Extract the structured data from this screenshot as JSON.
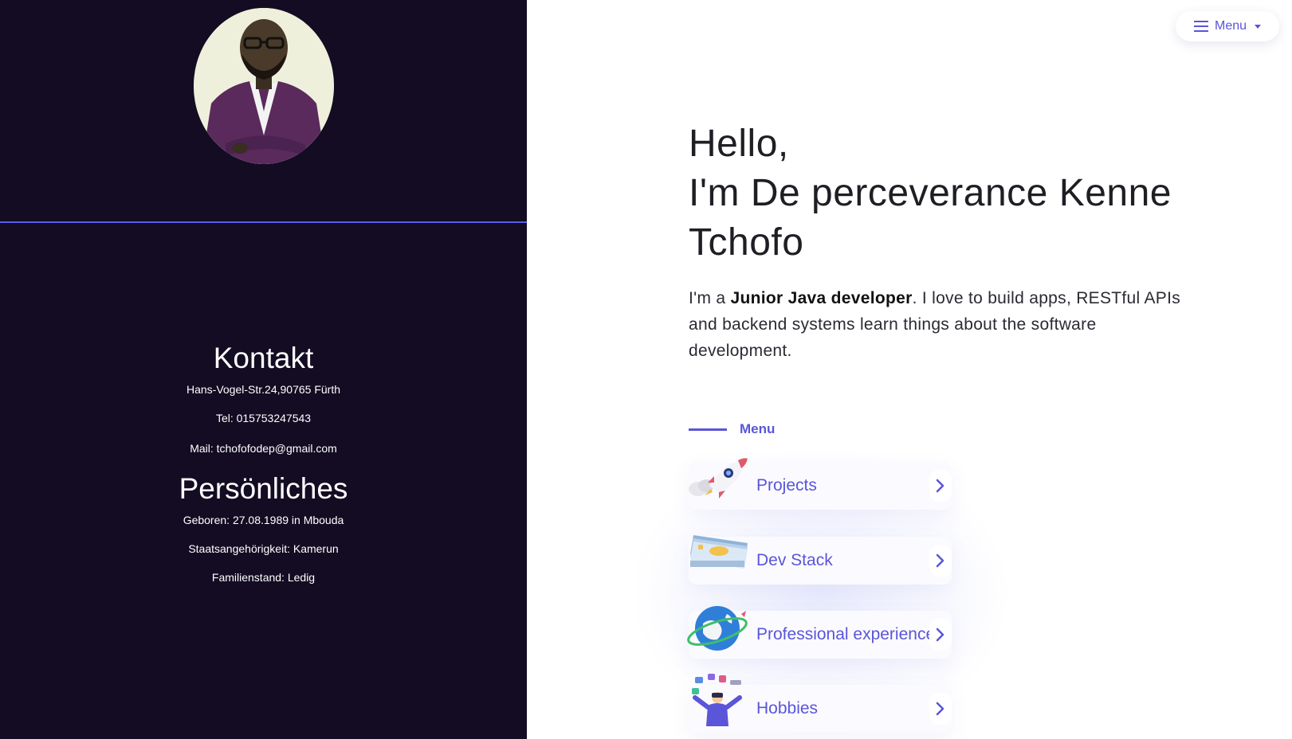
{
  "menu_button": {
    "label": "Menu",
    "icon": "hamburger-icon"
  },
  "profile": {
    "photo_alt": "profile photo"
  },
  "contact": {
    "heading": "Kontakt",
    "address": "Hans-Vogel-Str.24,90765 Fürth",
    "phone": "Tel: 015753247543",
    "mail": "Mail: tchofofodep@gmail.com"
  },
  "personal": {
    "heading": "Persönliches",
    "born": "Geboren: 27.08.1989 in Mbouda",
    "nationality": "Staatsangehörigkeit: Kamerun",
    "marital": "Familienstand: Ledig"
  },
  "hero": {
    "greeting": "Hello,",
    "name_line1": "I'm De perceverance Kenne",
    "name_line2": "Tchofo",
    "intro_prefix": "I'm a ",
    "intro_role": "Junior Java developer",
    "intro_rest": ". I love to build apps, RESTful APIs and backend systems learn things about the software development."
  },
  "menu_section": {
    "label": "Menu",
    "items": [
      {
        "label": "Projects",
        "icon": "rocket-icon"
      },
      {
        "label": "Dev Stack",
        "icon": "cash-stack-icon"
      },
      {
        "label": "Professional experience",
        "icon": "globe-icon"
      },
      {
        "label": "Hobbies",
        "icon": "juggling-person-icon"
      }
    ]
  },
  "colors": {
    "left_panel": "#130c23",
    "accent": "#5a55d9",
    "divider": "#5b5be8"
  }
}
